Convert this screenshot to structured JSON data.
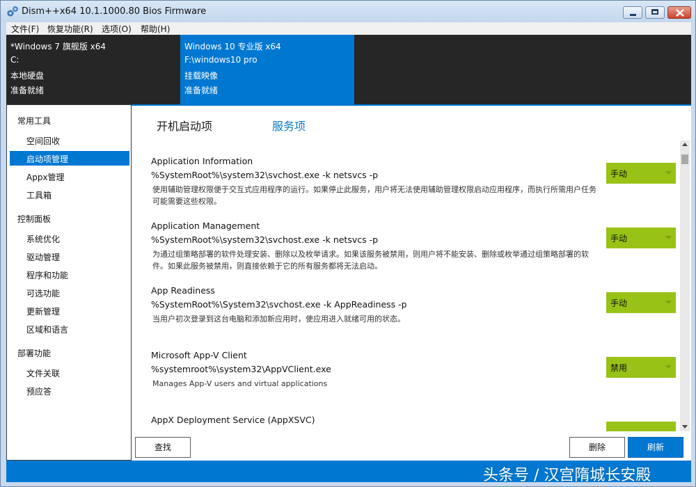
{
  "window": {
    "title": "Dism++x64 10.1.1000.80 Bios Firmware"
  },
  "menu": {
    "items": [
      {
        "label": "文件(F)"
      },
      {
        "label": "恢复功能(R)"
      },
      {
        "label": "选项(O)"
      },
      {
        "label": "帮助(H)"
      }
    ]
  },
  "images": [
    {
      "os": "*Windows 7 旗舰版 x64",
      "path": "C:",
      "type": "本地硬盘",
      "status": "准备就绪",
      "selected": false
    },
    {
      "os": "Windows 10 专业版 x64",
      "path": "F:\\windows10 pro",
      "type": "挂载映像",
      "status": "准备就绪",
      "selected": true
    }
  ],
  "sidebar": {
    "groups": [
      {
        "heading": "常用工具",
        "items": [
          "空间回收",
          "启动项管理",
          "Appx管理",
          "工具箱"
        ]
      },
      {
        "heading": "控制面板",
        "items": [
          "系统优化",
          "驱动管理",
          "程序和功能",
          "可选功能",
          "更新管理",
          "区域和语言"
        ]
      },
      {
        "heading": "部署功能",
        "items": [
          "文件关联",
          "预应答"
        ]
      }
    ],
    "active_item": "启动项管理"
  },
  "tabs": [
    {
      "label": "开机启动项",
      "active": false
    },
    {
      "label": "服务项",
      "active": true
    }
  ],
  "services": [
    {
      "name": "Application Information",
      "path": "%SystemRoot%\\system32\\svchost.exe -k netsvcs -p",
      "description": "使用辅助管理权限便于交互式应用程序的运行。如果停止此服务，用户将无法使用辅助管理权限启动应用程序，而执行所需用户任务可能需要这些权限。",
      "startup": "手动"
    },
    {
      "name": "Application Management",
      "path": "%SystemRoot%\\system32\\svchost.exe -k netsvcs -p",
      "description": "为通过组策略部署的软件处理安装、删除以及枚举请求。如果该服务被禁用，则用户将不能安装、删除或枚举通过组策略部署的软件。如果此服务被禁用，则直接依赖于它的所有服务都将无法启动。",
      "startup": "手动"
    },
    {
      "name": "App Readiness",
      "path": "%SystemRoot%\\System32\\svchost.exe -k AppReadiness -p",
      "description": "当用户初次登录到这台电脑和添加新应用时，使应用进入就绪可用的状态。",
      "startup": "手动"
    },
    {
      "name": "Microsoft App-V Client",
      "path": "%systemroot%\\system32\\AppVClient.exe",
      "description": "Manages App-V users and virtual applications",
      "startup": "禁用"
    },
    {
      "name": "AppX Deployment Service (AppXSVC)",
      "path": "",
      "description": "",
      "startup": ""
    }
  ],
  "buttons": {
    "find": "查找",
    "delete": "删除",
    "refresh": "刷新"
  },
  "watermark": "头条号 / 汉宫隋城长安殿",
  "colors": {
    "accent": "#0078d2",
    "dropdown": "#99c217",
    "image_strip": "#262626"
  },
  "icons": {
    "app": "gears-icon",
    "dropdown": "chevron-down-icon"
  }
}
